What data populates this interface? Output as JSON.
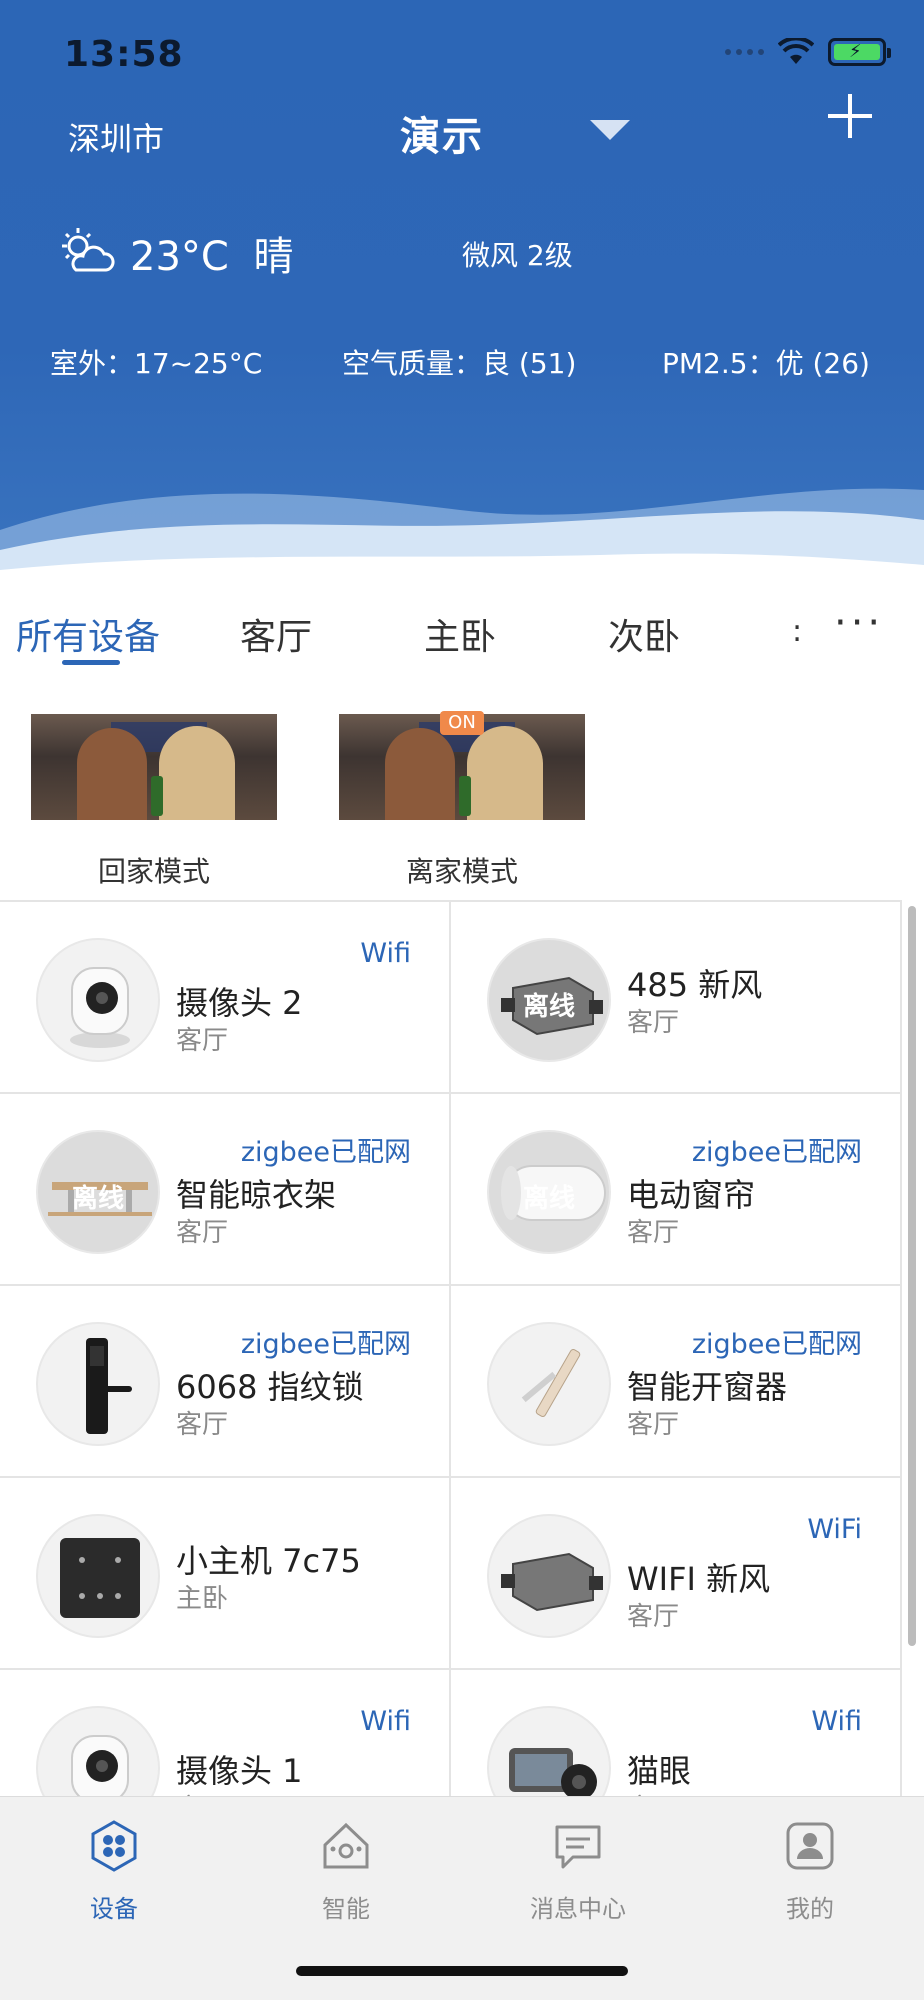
{
  "status_bar": {
    "time": "13:58"
  },
  "header": {
    "city": "深圳市",
    "home_name": "演示",
    "weather": {
      "temp": "23°C",
      "condition": "晴",
      "wind": "微风 2级"
    },
    "stats": {
      "outdoor": "室外：17~25°C",
      "air_quality": "空气质量：良 (51)",
      "pm25": "PM2.5：优 (26)"
    }
  },
  "tabs": [
    "所有设备",
    "客厅",
    "主卧",
    "次卧",
    "…"
  ],
  "scenes": [
    {
      "label": "回家模式",
      "on": false
    },
    {
      "label": "离家模式",
      "on": true,
      "badge": "ON"
    }
  ],
  "offline_label": "离线",
  "devices": [
    {
      "name": "摄像头 2",
      "room": "客厅",
      "tag": "Wifi",
      "offline": false,
      "icon": "camera-icon"
    },
    {
      "name": "485 新风",
      "room": "客厅",
      "tag": "",
      "offline": true,
      "icon": "air-purifier-icon"
    },
    {
      "name": "智能晾衣架",
      "room": "客厅",
      "tag": "zigbee已配网",
      "offline": true,
      "icon": "clothes-rack-icon"
    },
    {
      "name": "电动窗帘",
      "room": "客厅",
      "tag": "zigbee已配网",
      "offline": true,
      "icon": "curtain-motor-icon"
    },
    {
      "name": "6068 指纹锁",
      "room": "客厅",
      "tag": "zigbee已配网",
      "offline": false,
      "icon": "fingerprint-lock-icon"
    },
    {
      "name": "智能开窗器",
      "room": "客厅",
      "tag": "zigbee已配网",
      "offline": false,
      "icon": "window-opener-icon"
    },
    {
      "name": "小主机 7c75",
      "room": "主卧",
      "tag": "",
      "offline": false,
      "icon": "hub-panel-icon"
    },
    {
      "name": "WIFI 新风",
      "room": "客厅",
      "tag": "WiFi",
      "offline": false,
      "icon": "air-purifier-icon"
    },
    {
      "name": "摄像头 1",
      "room": "客厅",
      "tag": "Wifi",
      "offline": false,
      "icon": "camera-icon"
    },
    {
      "name": "猫眼",
      "room": "客厅",
      "tag": "Wifi",
      "offline": false,
      "icon": "door-viewer-icon"
    }
  ],
  "nav": [
    {
      "label": "设备",
      "icon": "devices-icon",
      "active": true
    },
    {
      "label": "智能",
      "icon": "smart-home-icon",
      "active": false
    },
    {
      "label": "消息中心",
      "icon": "message-icon",
      "active": false
    },
    {
      "label": "我的",
      "icon": "profile-icon",
      "active": false
    }
  ],
  "colors": {
    "primary": "#2c66b6",
    "tag": "#2c66b6",
    "badge": "#f0894a"
  }
}
